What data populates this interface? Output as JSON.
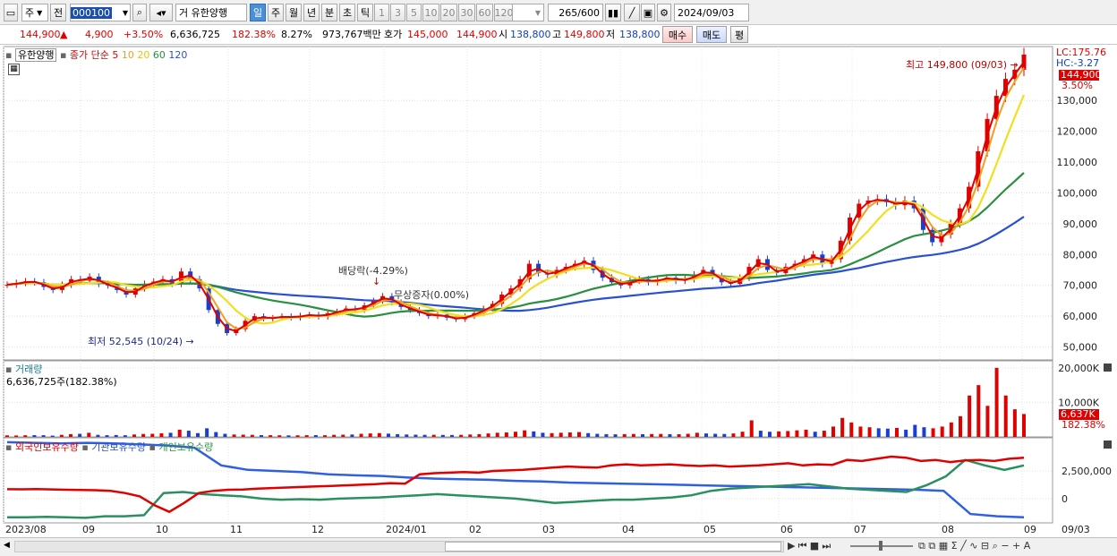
{
  "toolbar": {
    "market_select": "주",
    "prev_label": "전",
    "code_value": "000100",
    "name_prefix": "거",
    "stock_name": "유한양행",
    "periods": [
      "일",
      "주",
      "월",
      "년",
      "분",
      "초",
      "틱"
    ],
    "active_period": "일",
    "intervals": [
      "1",
      "3",
      "5",
      "10",
      "20",
      "30",
      "60",
      "120"
    ],
    "count_value": "265",
    "count_total": "/600",
    "date_value": "2024/09/03"
  },
  "quote": {
    "price": "144,900",
    "change_arrow": "▲",
    "change": "4,900",
    "change_pct": "+3.50%",
    "volume": "6,636,725",
    "volume_ratio": "182.38%",
    "turnover": "8.27%",
    "amount": "973,767백만",
    "ask_label": "호가",
    "ask1": "145,000",
    "ask2": "144,900",
    "open_label": "시",
    "open": "138,800",
    "high_label": "고",
    "high": "149,800",
    "low_label": "저",
    "low": "138,800",
    "buy_label": "매수",
    "sell_label": "매도",
    "eval_label": "평"
  },
  "legend": {
    "stock": "유한양행",
    "ma_label": "종가 단순",
    "ma_periods": [
      "5",
      "10",
      "20",
      "60",
      "120"
    ],
    "lc": "LC:175.76",
    "hc": "HC:-3.27",
    "last_price_tag": "144,900",
    "last_pct_tag": "3.50%"
  },
  "annotations": {
    "high_note": "최고 149,800 (09/03)",
    "low_note": "최저 52,545 (10/24)",
    "dividend_note": "배당락(-4.29%)",
    "bonus_note": "무상증자(0.00%)"
  },
  "volume_panel": {
    "title": "거래량",
    "info": "6,636,725주(182.38%)",
    "ticks": [
      "20,000K",
      "10,000K"
    ],
    "last_tag": "6,637K",
    "last_pct_tag": "182.38%"
  },
  "holdings_panel": {
    "foreign": "외국인보유수량",
    "institution": "기관보유수량",
    "individual": "개인보유수량",
    "ticks": [
      "2,500,000",
      "0"
    ]
  },
  "chart_data": {
    "type": "candlestick",
    "price_axis": {
      "ticks": [
        50000,
        60000,
        70000,
        80000,
        90000,
        100000,
        110000,
        120000,
        130000
      ],
      "ylim": [
        45800,
        147500
      ]
    },
    "x_labels": [
      "2023/08",
      "09",
      "10",
      "11",
      "12",
      "2024/01",
      "02",
      "03",
      "04",
      "05",
      "06",
      "07",
      "08",
      "09"
    ],
    "x_right_label": "09/03",
    "series": [
      {
        "name": "종가",
        "color": "#e00000",
        "values": [
          70200,
          70800,
          71300,
          71000,
          69500,
          68500,
          70200,
          72000,
          71500,
          72800,
          70500,
          70000,
          68500,
          67000,
          69000,
          70500,
          71200,
          72000,
          70500,
          74500,
          72000,
          69000,
          62000,
          57500,
          54500,
          55800,
          58500,
          60000,
          59200,
          59500,
          60000,
          59500,
          60200,
          60500,
          59800,
          61000,
          61500,
          62500,
          62000,
          63500,
          65000,
          66500,
          64500,
          63000,
          62000,
          61000,
          60000,
          60500,
          59500,
          59000,
          60000,
          61000,
          62500,
          64000,
          67000,
          69000,
          72000,
          77000,
          74000,
          73500,
          75000,
          76000,
          77000,
          78000,
          75000,
          72500,
          71000,
          70000,
          71500,
          72000,
          71000,
          72000,
          72500,
          71500,
          72000,
          73500,
          75000,
          73000,
          71000,
          70500,
          72500,
          76000,
          78500,
          75000,
          74000,
          76000,
          77000,
          78500,
          80000,
          77000,
          78500,
          84500,
          92000,
          96500,
          97500,
          98000,
          97000,
          96000,
          97500,
          95000,
          88000,
          84000,
          86500,
          90000,
          95000,
          102000,
          113500,
          124000,
          131500,
          137000,
          140000,
          144900
        ]
      },
      {
        "name": "5",
        "color": "#e00000"
      },
      {
        "name": "10",
        "color": "#f0a020"
      },
      {
        "name": "20",
        "color": "#e8e000"
      },
      {
        "name": "60",
        "color": "#2a9040"
      },
      {
        "name": "120",
        "color": "#2a50d0"
      }
    ],
    "volume_values_k": [
      450,
      420,
      480,
      520,
      500,
      380,
      600,
      800,
      900,
      1200,
      600,
      500,
      550,
      480,
      700,
      850,
      900,
      1050,
      1200,
      2100,
      1800,
      1100,
      2500,
      1400,
      900,
      700,
      650,
      600,
      520,
      500,
      480,
      450,
      470,
      500,
      520,
      480,
      600,
      650,
      700,
      900,
      1000,
      1100,
      950,
      800,
      700,
      650,
      600,
      620,
      580,
      560,
      600,
      700,
      800,
      1000,
      1200,
      1300,
      1500,
      1900,
      1600,
      1200,
      1100,
      1200,
      1300,
      1400,
      1100,
      900,
      800,
      750,
      800,
      850,
      780,
      820,
      860,
      800,
      780,
      900,
      1200,
      1000,
      900,
      850,
      1000,
      1500,
      4800,
      1800,
      1500,
      1600,
      1700,
      1900,
      2100,
      1500,
      1800,
      3000,
      5500,
      4200,
      3000,
      2800,
      2500,
      2400,
      2600,
      2100,
      3500,
      2800,
      2500,
      3000,
      4200,
      6000,
      12000,
      15000,
      9000,
      20000,
      12000,
      8000,
      6637
    ],
    "foreign_holdings": [
      850000,
      840000,
      860000,
      830000,
      800000,
      780000,
      760000,
      700000,
      500000,
      200000,
      -600000,
      -1200000,
      -400000,
      500000,
      700000,
      800000,
      820000,
      900000,
      950000,
      1000000,
      1050000,
      1100000,
      1150000,
      1200000,
      1250000,
      1300000,
      1400000,
      1350000,
      2200000,
      2300000,
      2350000,
      2400000,
      2350000,
      2500000,
      2550000,
      2600000,
      2700000,
      2800000,
      2900000,
      2850000,
      2800000,
      3000000,
      3100000,
      3000000,
      3050000,
      3100000,
      3000000,
      2950000,
      3000000,
      2900000,
      2950000,
      3000000,
      3100000,
      3200000,
      3000000,
      3100000,
      3050000,
      3500000,
      3400000,
      3600000,
      3800000,
      3700000,
      3400000,
      3500000,
      3300000,
      3450000,
      3500000,
      3400000,
      3600000,
      3700000
    ],
    "institution_holdings": [
      5100000,
      5050000,
      5000000,
      5050000,
      5000000,
      4900000,
      4800000,
      4600000,
      3000000,
      2600000,
      2500000,
      2400000,
      2200000,
      2100000,
      2050000,
      1900000,
      1800000,
      1750000,
      1700000,
      1600000,
      1550000,
      1450000,
      1400000,
      1350000,
      1300000,
      1250000,
      1200000,
      1150000,
      1100000,
      1050000,
      1000000,
      950000,
      900000,
      850000,
      800000,
      700000,
      -1400000,
      -1600000,
      -1700000
    ],
    "individual_holdings": [
      -1700000,
      -1700000,
      -1650000,
      -1700000,
      -1750000,
      -1600000,
      -1600000,
      -1500000,
      500000,
      600000,
      400000,
      300000,
      200000,
      0,
      -100000,
      -50000,
      -100000,
      0,
      50000,
      100000,
      200000,
      300000,
      400000,
      300000,
      200000,
      100000,
      0,
      -200000,
      -400000,
      -300000,
      -200000,
      -100000,
      -100000,
      0,
      100000,
      300000,
      700000,
      900000,
      1000000,
      1100000,
      1200000,
      1300000,
      1100000,
      900000,
      800000,
      700000,
      600000,
      1200000,
      2000000,
      3500000,
      3000000,
      2600000,
      3000000
    ]
  }
}
